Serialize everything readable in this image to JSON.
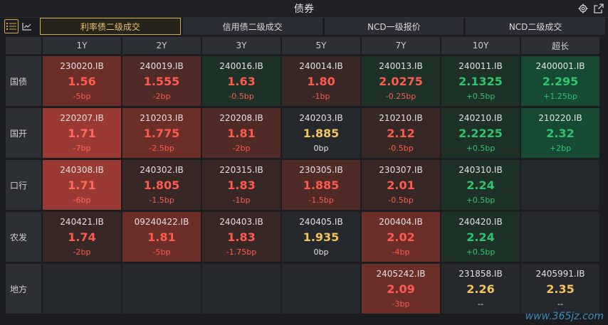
{
  "window": {
    "title": "债券"
  },
  "tabs": [
    {
      "label": "利率债二级成交",
      "active": true
    },
    {
      "label": "信用债二级成交",
      "active": false
    },
    {
      "label": "NCD一级报价",
      "active": false
    },
    {
      "label": "NCD二级成交",
      "active": false
    }
  ],
  "columns": [
    "1Y",
    "2Y",
    "3Y",
    "5Y",
    "7Y",
    "10Y",
    "超长"
  ],
  "rows": [
    {
      "label": "国债",
      "cells": [
        {
          "code": "230020.IB",
          "yield": "1.56",
          "change": "-5bp",
          "tone": "red2",
          "ycolor": "#ff5a4e",
          "ccolor": "#ff5a4e"
        },
        {
          "code": "240019.IB",
          "yield": "1.555",
          "change": "-2bp",
          "tone": "red1",
          "ycolor": "#ff5a4e",
          "ccolor": "#ff5a4e"
        },
        {
          "code": "240016.IB",
          "yield": "1.63",
          "change": "-0.5bp",
          "tone": "dgreen",
          "ycolor": "#ff5a4e",
          "ccolor": "#ff5a4e"
        },
        {
          "code": "240014.IB",
          "yield": "1.80",
          "change": "-1bp",
          "tone": "red0",
          "ycolor": "#ff5a4e",
          "ccolor": "#ff5a4e"
        },
        {
          "code": "240013.IB",
          "yield": "2.0275",
          "change": "-0.25bp",
          "tone": "dgreen",
          "ycolor": "#ff5a4e",
          "ccolor": "#ff5a4e"
        },
        {
          "code": "240011.IB",
          "yield": "2.1325",
          "change": "+0.5bp",
          "tone": "dgreen",
          "ycolor": "#2fc46e",
          "ccolor": "#2fc46e"
        },
        {
          "code": "2400001.IB",
          "yield": "2.295",
          "change": "+1.25bp",
          "tone": "green",
          "ycolor": "#2fc46e",
          "ccolor": "#2fc46e"
        }
      ]
    },
    {
      "label": "国开",
      "cells": [
        {
          "code": "220207.IB",
          "yield": "1.71",
          "change": "-7bp",
          "tone": "red3",
          "ycolor": "#ff6a5a",
          "ccolor": "#ff6a5a"
        },
        {
          "code": "210203.IB",
          "yield": "1.775",
          "change": "-2.5bp",
          "tone": "red2",
          "ycolor": "#ff5a4e",
          "ccolor": "#ff5a4e"
        },
        {
          "code": "220208.IB",
          "yield": "1.81",
          "change": "-2bp",
          "tone": "red1",
          "ycolor": "#ff5a4e",
          "ccolor": "#ff5a4e"
        },
        {
          "code": "240203.IB",
          "yield": "1.885",
          "change": "0bp",
          "tone": "neutral",
          "ycolor": "#f2c45a",
          "ccolor": "#e6e6e6"
        },
        {
          "code": "210210.IB",
          "yield": "2.12",
          "change": "-0.5bp",
          "tone": "red0",
          "ycolor": "#ff5a4e",
          "ccolor": "#ff5a4e"
        },
        {
          "code": "240210.IB",
          "yield": "2.2225",
          "change": "+0.5bp",
          "tone": "dgreen",
          "ycolor": "#2fc46e",
          "ccolor": "#2fc46e"
        },
        {
          "code": "210220.IB",
          "yield": "2.32",
          "change": "+2bp",
          "tone": "green",
          "ycolor": "#2fc46e",
          "ccolor": "#2fc46e"
        }
      ]
    },
    {
      "label": "口行",
      "cells": [
        {
          "code": "240308.IB",
          "yield": "1.71",
          "change": "-6bp",
          "tone": "red3",
          "ycolor": "#ff6a5a",
          "ccolor": "#ff6a5a"
        },
        {
          "code": "240302.IB",
          "yield": "1.805",
          "change": "-1.5bp",
          "tone": "red0",
          "ycolor": "#ff5a4e",
          "ccolor": "#ff5a4e"
        },
        {
          "code": "220315.IB",
          "yield": "1.83",
          "change": "-1bp",
          "tone": "red0",
          "ycolor": "#ff5a4e",
          "ccolor": "#ff5a4e"
        },
        {
          "code": "230305.IB",
          "yield": "1.885",
          "change": "-1.5bp",
          "tone": "red1",
          "ycolor": "#ff5a4e",
          "ccolor": "#ff5a4e"
        },
        {
          "code": "230307.IB",
          "yield": "2.01",
          "change": "-0.5bp",
          "tone": "red0",
          "ycolor": "#ff5a4e",
          "ccolor": "#ff5a4e"
        },
        {
          "code": "240310.IB",
          "yield": "2.24",
          "change": "+0.5bp",
          "tone": "dgreen",
          "ycolor": "#2fc46e",
          "ccolor": "#2fc46e"
        },
        null
      ]
    },
    {
      "label": "农发",
      "cells": [
        {
          "code": "240421.IB",
          "yield": "1.74",
          "change": "-2bp",
          "tone": "red0",
          "ycolor": "#ff5a4e",
          "ccolor": "#ff5a4e"
        },
        {
          "code": "09240422.IB",
          "yield": "1.81",
          "change": "-5bp",
          "tone": "red2",
          "ycolor": "#ff5a4e",
          "ccolor": "#ff5a4e"
        },
        {
          "code": "240403.IB",
          "yield": "1.83",
          "change": "-1.75bp",
          "tone": "red0",
          "ycolor": "#ff5a4e",
          "ccolor": "#ff5a4e"
        },
        {
          "code": "240405.IB",
          "yield": "1.935",
          "change": "0bp",
          "tone": "neutral",
          "ycolor": "#f2c45a",
          "ccolor": "#e6e6e6"
        },
        {
          "code": "200404.IB",
          "yield": "2.02",
          "change": "-4bp",
          "tone": "red2",
          "ycolor": "#ff5a4e",
          "ccolor": "#ff5a4e"
        },
        {
          "code": "240420.IB",
          "yield": "2.24",
          "change": "+0.5bp",
          "tone": "dgreen",
          "ycolor": "#2fc46e",
          "ccolor": "#2fc46e"
        },
        null
      ]
    },
    {
      "label": "地方",
      "cells": [
        null,
        null,
        null,
        null,
        {
          "code": "2405242.IB",
          "yield": "2.09",
          "change": "-3bp",
          "tone": "red2",
          "ycolor": "#ff5a4e",
          "ccolor": "#ff5a4e"
        },
        {
          "code": "231858.IB",
          "yield": "2.26",
          "change": "--",
          "tone": "neutral",
          "ycolor": "#f2c45a",
          "ccolor": "#e6e6e6"
        },
        {
          "code": "2405991.IB",
          "yield": "2.35",
          "change": "--",
          "tone": "neutral",
          "ycolor": "#f2c45a",
          "ccolor": "#e6e6e6"
        }
      ]
    }
  ],
  "tones": {
    "red3": "#9b3a32",
    "red2": "#6b2e29",
    "red1": "#4f2a27",
    "red0": "#372826",
    "neutral": "#25282d",
    "dgreen": "#1d3127",
    "green": "#174a33"
  },
  "watermark": "www.365jz.com"
}
